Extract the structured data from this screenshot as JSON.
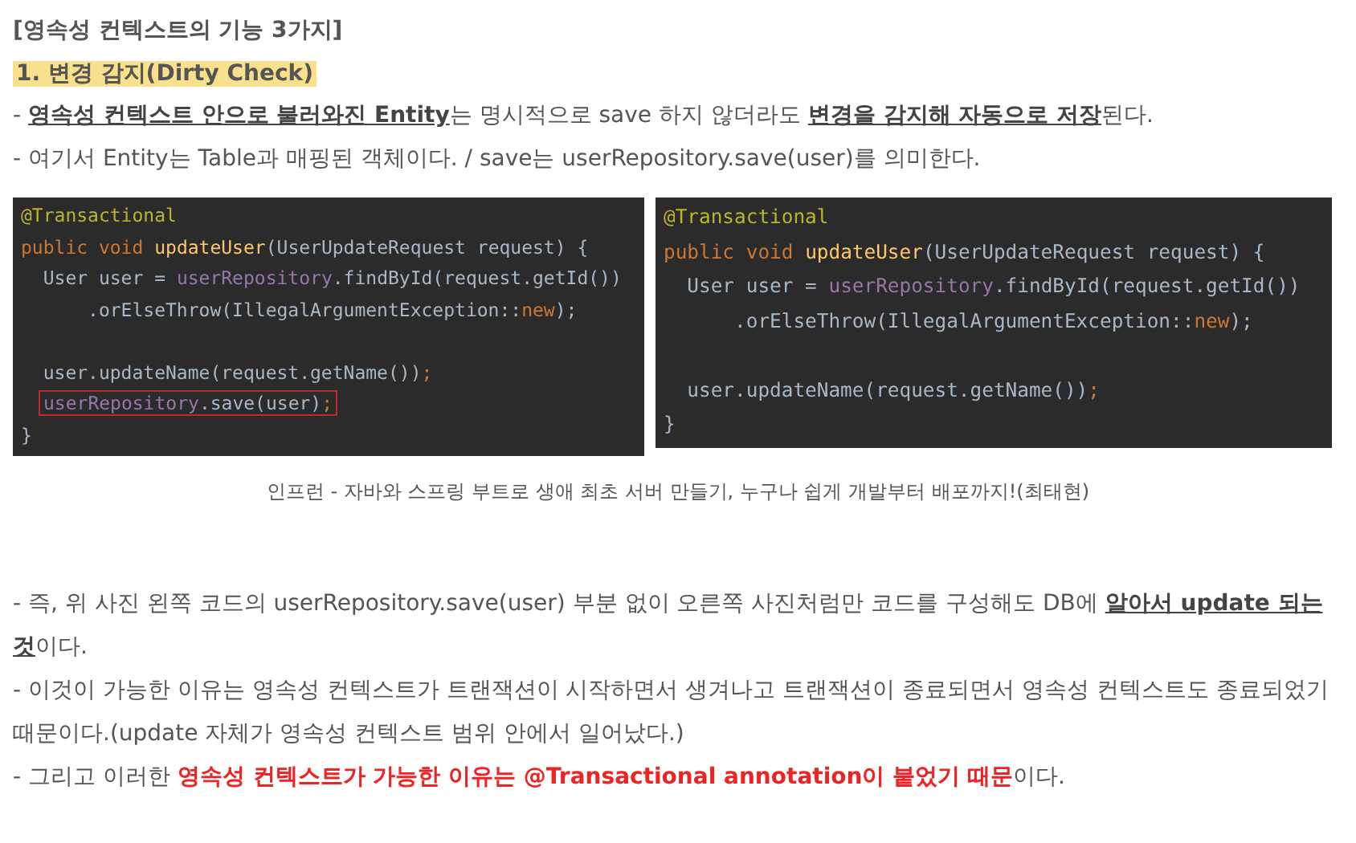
{
  "heading": "[영속성 컨텍스트의 기능 3가지]",
  "subheading": "1. 변경 감지(Dirty Check)",
  "intro": [
    "- **영속성 컨텍스트 안으로 불러와진 Entity**는 명시적으로 save 하지 않더라도 **변경을 감지해 자동으로 저장**된다.",
    "- 여기서 Entity는 Table과 매핑된 객체이다.  /  save는 userRepository.save(user)를 의미한다."
  ],
  "code_images": [
    {
      "lines": [
        {
          "kind": "code",
          "boxed": false,
          "tokens": [
            {
              "t": "@Transactional",
              "kind": "annotation"
            }
          ]
        },
        {
          "kind": "code",
          "boxed": false,
          "tokens": [
            {
              "t": "public void ",
              "kind": "keyword"
            },
            {
              "t": "updateUser",
              "kind": "method"
            },
            {
              "t": "(UserUpdateRequest request) {",
              "kind": "plain"
            }
          ]
        },
        {
          "kind": "code",
          "boxed": false,
          "tokens": [
            {
              "t": "  User user = ",
              "kind": "plain"
            },
            {
              "t": "userRepository",
              "kind": "field"
            },
            {
              "t": ".findById(request.getId())",
              "kind": "plain"
            }
          ]
        },
        {
          "kind": "code",
          "boxed": false,
          "tokens": [
            {
              "t": "      .orElseThrow(IllegalArgumentException::",
              "kind": "plain"
            },
            {
              "t": "new",
              "kind": "keyword"
            },
            {
              "t": ");",
              "kind": "plain"
            }
          ]
        },
        {
          "kind": "blank"
        },
        {
          "kind": "code",
          "boxed": false,
          "tokens": [
            {
              "t": "  user.updateName(request.getName())",
              "kind": "plain"
            },
            {
              "t": ";",
              "kind": "keyword"
            }
          ]
        },
        {
          "kind": "code",
          "boxed": true,
          "tokens": [
            {
              "t": "userRepository",
              "kind": "field"
            },
            {
              "t": ".save(user)",
              "kind": "plain"
            },
            {
              "t": ";",
              "kind": "keyword"
            }
          ]
        },
        {
          "kind": "code",
          "boxed": false,
          "tokens": [
            {
              "t": "}",
              "kind": "plain"
            }
          ]
        }
      ]
    },
    {
      "lines": [
        {
          "kind": "code",
          "boxed": false,
          "tokens": [
            {
              "t": "@Transactional",
              "kind": "annotation"
            }
          ]
        },
        {
          "kind": "code",
          "boxed": false,
          "tokens": [
            {
              "t": "public void ",
              "kind": "keyword"
            },
            {
              "t": "updateUser",
              "kind": "method"
            },
            {
              "t": "(UserUpdateRequest request) {",
              "kind": "plain"
            }
          ]
        },
        {
          "kind": "code",
          "boxed": false,
          "tokens": [
            {
              "t": "  User user = ",
              "kind": "plain"
            },
            {
              "t": "userRepository",
              "kind": "field"
            },
            {
              "t": ".findById(request.getId())",
              "kind": "plain"
            }
          ]
        },
        {
          "kind": "code",
          "boxed": false,
          "tokens": [
            {
              "t": "      .orElseThrow(IllegalArgumentException::",
              "kind": "plain"
            },
            {
              "t": "new",
              "kind": "keyword"
            },
            {
              "t": ");",
              "kind": "plain"
            }
          ]
        },
        {
          "kind": "blank"
        },
        {
          "kind": "code",
          "boxed": false,
          "tokens": [
            {
              "t": "  user.updateName(request.getName())",
              "kind": "plain"
            },
            {
              "t": ";",
              "kind": "keyword"
            }
          ]
        },
        {
          "kind": "code",
          "boxed": false,
          "tokens": [
            {
              "t": "}",
              "kind": "plain"
            }
          ]
        }
      ]
    }
  ],
  "caption": "인프런 - 자바와 스프링 부트로 생애 최초 서버 만들기, 누구나 쉽게 개발부터 배포까지!(최태현)",
  "body": [
    {
      "kind": "plain",
      "text": "- 즉, 위 사진 왼쪽 코드의 userRepository.save(user) 부분 없이 오른쪽 사진처럼만 코드를 구성해도 DB에 **알아서 update 되는 것**이다."
    },
    {
      "kind": "plain",
      "text": "- 이것이 가능한 이유는 영속성 컨텍스트가 트랜잭션이 시작하면서 생겨나고 트랜잭션이 종료되면서 영속성 컨텍스트도 종료되었기 때문이다.(update 자체가 영속성 컨텍스트 범위 안에서 일어났다.)"
    },
    {
      "kind": "alert",
      "text": "- 그리고 이러한  **영속성 컨텍스트가 가능한 이유는 @Transactional annotation이 붙었기 때문**이다."
    }
  ]
}
